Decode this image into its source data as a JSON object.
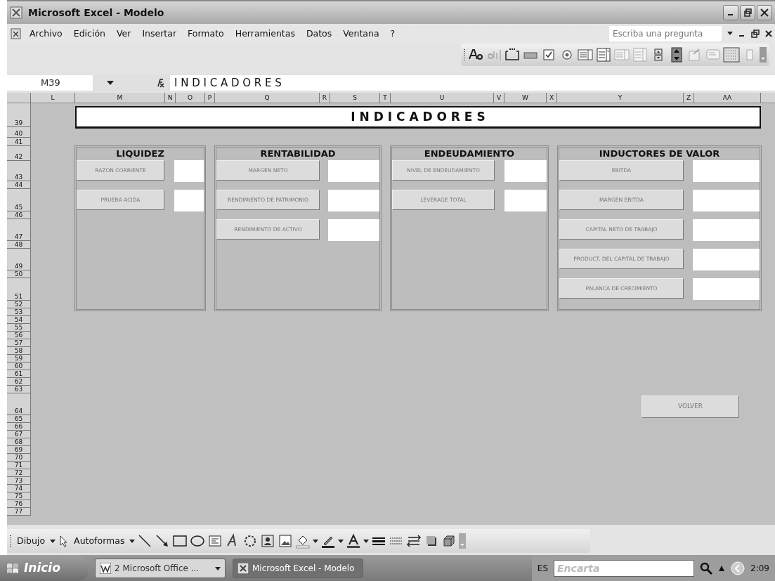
{
  "window": {
    "title": "Microsoft Excel - Modelo"
  },
  "menu": [
    {
      "label": "Archivo"
    },
    {
      "label": "Edición"
    },
    {
      "label": "Ver"
    },
    {
      "label": "Insertar"
    },
    {
      "label": "Formato"
    },
    {
      "label": "Herramientas"
    },
    {
      "label": "Datos"
    },
    {
      "label": "Ventana"
    },
    {
      "label": "?"
    }
  ],
  "question_box": {
    "placeholder": "Escriba una pregunta"
  },
  "formula_bar": {
    "name_box": "M39",
    "formula": "I N D I C A D O R E S"
  },
  "columns": [
    "L",
    "M",
    "N",
    "O",
    "P",
    "Q",
    "R",
    "S",
    "T",
    "U",
    "V",
    "W",
    "X",
    "Y",
    "Z",
    "AA"
  ],
  "rows": [
    "39",
    "40",
    "41",
    "42",
    "43",
    "44",
    "45",
    "46",
    "47",
    "48",
    "49",
    "50",
    "51",
    "52",
    "53",
    "54",
    "55",
    "56",
    "57",
    "58",
    "59",
    "60",
    "61",
    "62",
    "63",
    "64",
    "65",
    "66",
    "67",
    "68",
    "69",
    "70",
    "71",
    "72",
    "73",
    "74",
    "75",
    "76",
    "77"
  ],
  "sheet": {
    "title": "I N D I C A D O R E S",
    "panels": [
      {
        "title": "LIQUIDEZ",
        "buttons": [
          "RAZON CORRIENTE",
          "PRUEBA ACIDA"
        ]
      },
      {
        "title": "RENTABILIDAD",
        "buttons": [
          "MARGEN NETO",
          "RENDIMIENTO DE PATRIMONIO",
          "RENDIMIENTO DE ACTIVO"
        ]
      },
      {
        "title": "ENDEUDAMIENTO",
        "buttons": [
          "NIVEL DE ENDEUDAMIENTO",
          "LEVERAGE TOTAL"
        ]
      },
      {
        "title": "INDUCTORES DE VALOR",
        "buttons": [
          "EBITDA",
          "MARGEN EBITDA",
          "CAPITAL NETO DE TRABAJO",
          "PRODUCT. DEL CAPITAL DE TRABAJO",
          "PALANCA DE CRECIMIENTO"
        ]
      }
    ],
    "return_button": "VOLVER"
  },
  "drawing_toolbar": {
    "draw_menu": "Dibujo",
    "autoshapes_menu": "Autoformas"
  },
  "taskbar": {
    "start": "Inicio",
    "tasks": [
      {
        "label": "2 Microsoft Office ...",
        "selected": false,
        "dropdown": true
      },
      {
        "label": "Microsoft Excel - Modelo",
        "selected": true,
        "dropdown": false
      }
    ],
    "language": "ES",
    "search": {
      "placeholder": "Encarta"
    },
    "clock": "2:09"
  }
}
